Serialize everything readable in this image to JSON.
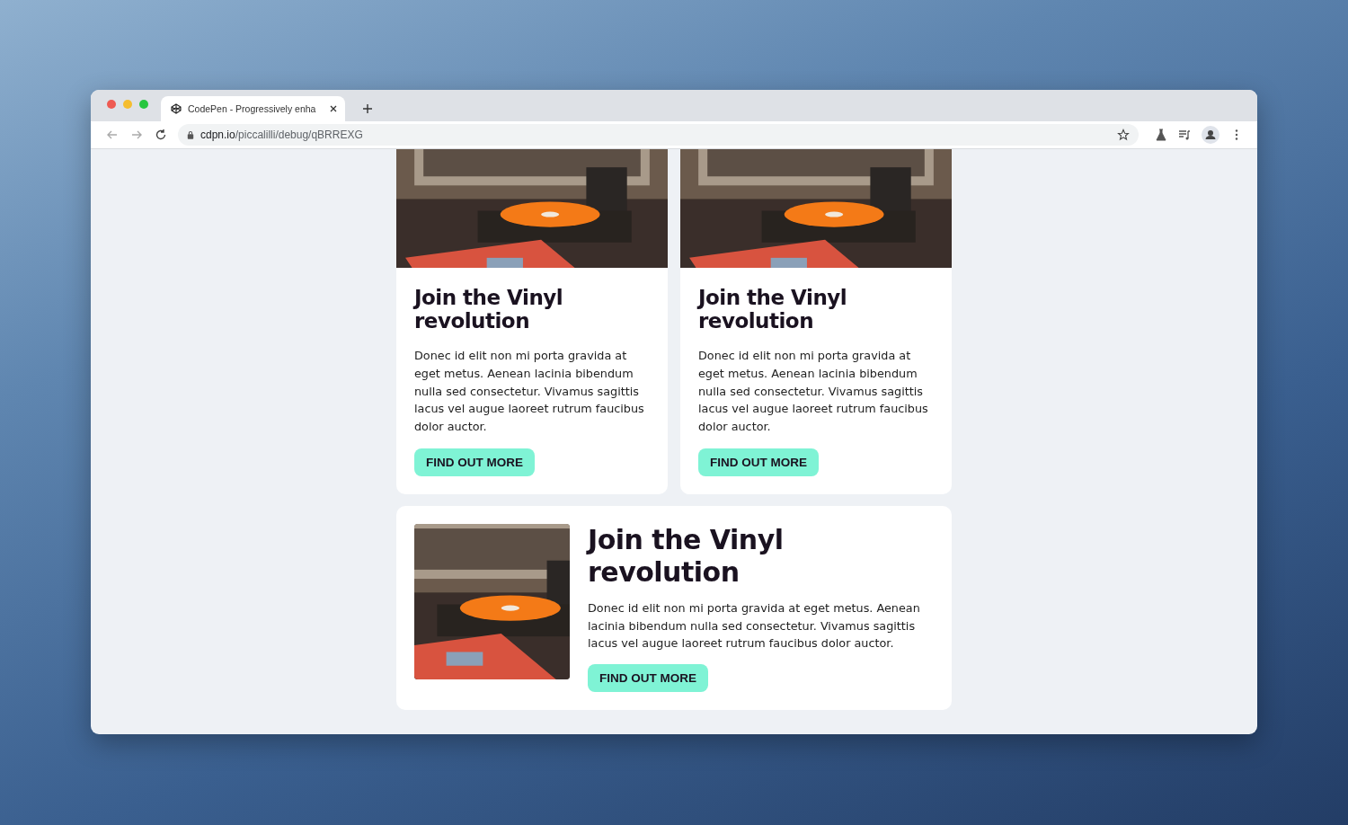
{
  "browser": {
    "tab_title": "CodePen - Progressively enha",
    "url_host": "cdpn.io",
    "url_path": "/piccalilli/debug/qBRREXG"
  },
  "cards": [
    {
      "kind": "vertical",
      "title": "Join the Vinyl revolution",
      "body": "Donec id elit non mi porta gravida at eget metus. Aenean lacinia bibendum nulla sed consectetur. Vivamus sagittis lacus vel augue laoreet rutrum faucibus dolor auctor.",
      "button": "FIND OUT MORE"
    },
    {
      "kind": "vertical",
      "title": "Join the Vinyl revolution",
      "body": "Donec id elit non mi porta gravida at eget metus. Aenean lacinia bibendum nulla sed consectetur. Vivamus sagittis lacus vel augue laoreet rutrum faucibus dolor auctor.",
      "button": "FIND OUT MORE"
    },
    {
      "kind": "horizontal",
      "title": "Join the Vinyl revolution",
      "body": "Donec id elit non mi porta gravida at eget metus. Aenean lacinia bibendum nulla sed consectetur. Vivamus sagittis lacus vel augue laoreet rutrum faucibus dolor auctor.",
      "button": "FIND OUT MORE"
    }
  ]
}
